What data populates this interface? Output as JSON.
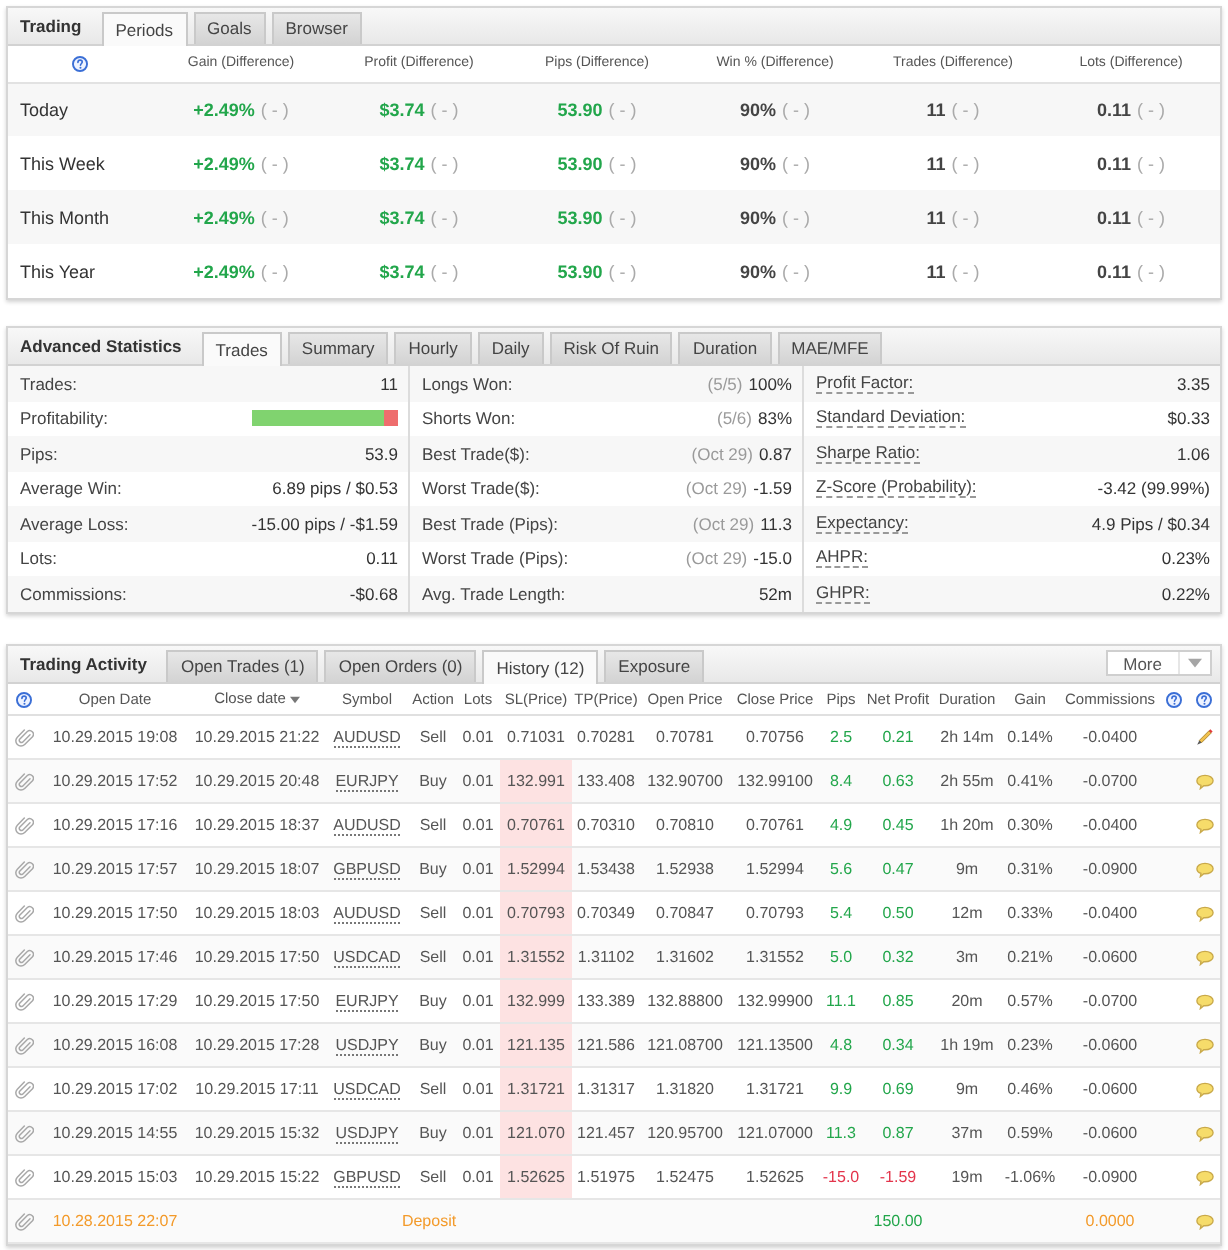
{
  "trading": {
    "title": "Trading",
    "tabs": [
      {
        "label": "Periods",
        "selected": true
      },
      {
        "label": "Goals",
        "selected": false
      },
      {
        "label": "Browser",
        "selected": false
      }
    ],
    "columns": [
      "Gain (Difference)",
      "Profit (Difference)",
      "Pips (Difference)",
      "Win % (Difference)",
      "Trades (Difference)",
      "Lots (Difference)"
    ],
    "rows": [
      {
        "period": "Today",
        "cells": [
          {
            "value": "+2.49%",
            "difference": "( - )",
            "positive": true
          },
          {
            "value": "$3.74",
            "difference": "( - )",
            "positive": true
          },
          {
            "value": "53.90",
            "difference": "( - )",
            "positive": true
          },
          {
            "value": "90%",
            "difference": "( - )",
            "positive": false
          },
          {
            "value": "11",
            "difference": "( - )",
            "positive": false
          },
          {
            "value": "0.11",
            "difference": "( - )",
            "positive": false
          }
        ]
      },
      {
        "period": "This Week",
        "cells": [
          {
            "value": "+2.49%",
            "difference": "( - )",
            "positive": true
          },
          {
            "value": "$3.74",
            "difference": "( - )",
            "positive": true
          },
          {
            "value": "53.90",
            "difference": "( - )",
            "positive": true
          },
          {
            "value": "90%",
            "difference": "( - )",
            "positive": false
          },
          {
            "value": "11",
            "difference": "( - )",
            "positive": false
          },
          {
            "value": "0.11",
            "difference": "( - )",
            "positive": false
          }
        ]
      },
      {
        "period": "This Month",
        "cells": [
          {
            "value": "+2.49%",
            "difference": "( - )",
            "positive": true
          },
          {
            "value": "$3.74",
            "difference": "( - )",
            "positive": true
          },
          {
            "value": "53.90",
            "difference": "( - )",
            "positive": true
          },
          {
            "value": "90%",
            "difference": "( - )",
            "positive": false
          },
          {
            "value": "11",
            "difference": "( - )",
            "positive": false
          },
          {
            "value": "0.11",
            "difference": "( - )",
            "positive": false
          }
        ]
      },
      {
        "period": "This Year",
        "cells": [
          {
            "value": "+2.49%",
            "difference": "( - )",
            "positive": true
          },
          {
            "value": "$3.74",
            "difference": "( - )",
            "positive": true
          },
          {
            "value": "53.90",
            "difference": "( - )",
            "positive": true
          },
          {
            "value": "90%",
            "difference": "( - )",
            "positive": false
          },
          {
            "value": "11",
            "difference": "( - )",
            "positive": false
          },
          {
            "value": "0.11",
            "difference": "( - )",
            "positive": false
          }
        ]
      }
    ]
  },
  "advanced_statistics": {
    "title": "Advanced Statistics",
    "tabs": [
      {
        "label": "Trades",
        "selected": true
      },
      {
        "label": "Summary",
        "selected": false
      },
      {
        "label": "Hourly",
        "selected": false
      },
      {
        "label": "Daily",
        "selected": false
      },
      {
        "label": "Risk Of Ruin",
        "selected": false
      },
      {
        "label": "Duration",
        "selected": false
      },
      {
        "label": "MAE/MFE",
        "selected": false
      }
    ],
    "columns": [
      {
        "tooltips": false,
        "stats": [
          {
            "kind": "value",
            "label": "Trades:",
            "value": "11"
          },
          {
            "kind": "bar",
            "label": "Profitability:",
            "level": 0.91
          },
          {
            "kind": "value",
            "label": "Pips:",
            "value": "53.9"
          },
          {
            "kind": "value",
            "label": "Average Win:",
            "value": "6.89 pips / $0.53"
          },
          {
            "kind": "value",
            "label": "Average Loss:",
            "value": "-15.00 pips / -$1.59"
          },
          {
            "kind": "value",
            "label": "Lots:",
            "value": "0.11"
          },
          {
            "kind": "value",
            "label": "Commissions:",
            "value": "-$0.68"
          }
        ]
      },
      {
        "tooltips": false,
        "stats": [
          {
            "kind": "value",
            "label": "Longs Won:",
            "note": "(5/5)",
            "value": "100%"
          },
          {
            "kind": "value",
            "label": "Shorts Won:",
            "note": "(5/6)",
            "value": "83%"
          },
          {
            "kind": "value",
            "label": "Best Trade($):",
            "note": "(Oct 29)",
            "value": "0.87"
          },
          {
            "kind": "value",
            "label": "Worst Trade($):",
            "note": "(Oct 29)",
            "value": "-1.59"
          },
          {
            "kind": "value",
            "label": "Best Trade (Pips):",
            "note": "(Oct 29)",
            "value": "11.3"
          },
          {
            "kind": "value",
            "label": "Worst Trade (Pips):",
            "note": "(Oct 29)",
            "value": "-15.0"
          },
          {
            "kind": "value",
            "label": "Avg. Trade Length:",
            "value": "52m"
          }
        ]
      },
      {
        "tooltips": true,
        "stats": [
          {
            "kind": "value",
            "label": "Profit Factor:",
            "value": "3.35"
          },
          {
            "kind": "value",
            "label": "Standard Deviation:",
            "value": "$0.33"
          },
          {
            "kind": "value",
            "label": "Sharpe Ratio:",
            "value": "1.06"
          },
          {
            "kind": "value",
            "label": "Z-Score (Probability):",
            "value": "-3.42 (99.99%)"
          },
          {
            "kind": "value",
            "label": "Expectancy:",
            "value": "4.9 Pips / $0.34"
          },
          {
            "kind": "value",
            "label": "AHPR:",
            "value": "0.23%"
          },
          {
            "kind": "value",
            "label": "GHPR:",
            "value": "0.22%"
          }
        ]
      }
    ]
  },
  "trading_activity": {
    "title": "Trading Activity",
    "tabs": [
      {
        "label": "Open Trades (1)",
        "selected": false
      },
      {
        "label": "Open Orders (0)",
        "selected": false
      },
      {
        "label": "History (12)",
        "selected": true
      },
      {
        "label": "Exposure",
        "selected": false
      }
    ],
    "more_button": "More",
    "columns": [
      {
        "label": "Open Date",
        "sorted": false
      },
      {
        "label": "Close date",
        "sorted": true
      },
      {
        "label": "Symbol",
        "sorted": false
      },
      {
        "label": "Action",
        "sorted": false
      },
      {
        "label": "Lots",
        "sorted": false
      },
      {
        "label": "SL(Price)",
        "sorted": false
      },
      {
        "label": "TP(Price)",
        "sorted": false
      },
      {
        "label": "Open Price",
        "sorted": false
      },
      {
        "label": "Close Price",
        "sorted": false
      },
      {
        "label": "Pips",
        "sorted": false
      },
      {
        "label": "Net Profit",
        "sorted": false
      },
      {
        "label": "Duration",
        "sorted": false
      },
      {
        "label": "Gain",
        "sorted": false
      },
      {
        "label": "Commissions",
        "sorted": false
      }
    ],
    "rows": [
      {
        "kind": "trade",
        "open_date": "10.29.2015 19:08",
        "close_date": "10.29.2015 21:22",
        "symbol": "AUDUSD",
        "action": "Sell",
        "lots": "0.01",
        "sl_price": "0.71031",
        "sl_highlight": false,
        "tp_price": "0.70281",
        "open_price": "0.70781",
        "close_price": "0.70756",
        "pips": "2.5",
        "net_profit": "0.21",
        "duration": "2h 14m",
        "gain": "0.14%",
        "commissions": "-0.0400",
        "loss": false,
        "has_comment": false
      },
      {
        "kind": "trade",
        "open_date": "10.29.2015 17:52",
        "close_date": "10.29.2015 20:48",
        "symbol": "EURJPY",
        "action": "Buy",
        "lots": "0.01",
        "sl_price": "132.991",
        "sl_highlight": true,
        "tp_price": "133.408",
        "open_price": "132.90700",
        "close_price": "132.99100",
        "pips": "8.4",
        "net_profit": "0.63",
        "duration": "2h 55m",
        "gain": "0.41%",
        "commissions": "-0.0700",
        "loss": false,
        "has_comment": true
      },
      {
        "kind": "trade",
        "open_date": "10.29.2015 17:16",
        "close_date": "10.29.2015 18:37",
        "symbol": "AUDUSD",
        "action": "Sell",
        "lots": "0.01",
        "sl_price": "0.70761",
        "sl_highlight": true,
        "tp_price": "0.70310",
        "open_price": "0.70810",
        "close_price": "0.70761",
        "pips": "4.9",
        "net_profit": "0.45",
        "duration": "1h 20m",
        "gain": "0.30%",
        "commissions": "-0.0400",
        "loss": false,
        "has_comment": true
      },
      {
        "kind": "trade",
        "open_date": "10.29.2015 17:57",
        "close_date": "10.29.2015 18:07",
        "symbol": "GBPUSD",
        "action": "Buy",
        "lots": "0.01",
        "sl_price": "1.52994",
        "sl_highlight": true,
        "tp_price": "1.53438",
        "open_price": "1.52938",
        "close_price": "1.52994",
        "pips": "5.6",
        "net_profit": "0.47",
        "duration": "9m",
        "gain": "0.31%",
        "commissions": "-0.0900",
        "loss": false,
        "has_comment": true
      },
      {
        "kind": "trade",
        "open_date": "10.29.2015 17:50",
        "close_date": "10.29.2015 18:03",
        "symbol": "AUDUSD",
        "action": "Sell",
        "lots": "0.01",
        "sl_price": "0.70793",
        "sl_highlight": true,
        "tp_price": "0.70349",
        "open_price": "0.70847",
        "close_price": "0.70793",
        "pips": "5.4",
        "net_profit": "0.50",
        "duration": "12m",
        "gain": "0.33%",
        "commissions": "-0.0400",
        "loss": false,
        "has_comment": true
      },
      {
        "kind": "trade",
        "open_date": "10.29.2015 17:46",
        "close_date": "10.29.2015 17:50",
        "symbol": "USDCAD",
        "action": "Sell",
        "lots": "0.01",
        "sl_price": "1.31552",
        "sl_highlight": true,
        "tp_price": "1.31102",
        "open_price": "1.31602",
        "close_price": "1.31552",
        "pips": "5.0",
        "net_profit": "0.32",
        "duration": "3m",
        "gain": "0.21%",
        "commissions": "-0.0600",
        "loss": false,
        "has_comment": true
      },
      {
        "kind": "trade",
        "open_date": "10.29.2015 17:29",
        "close_date": "10.29.2015 17:50",
        "symbol": "EURJPY",
        "action": "Buy",
        "lots": "0.01",
        "sl_price": "132.999",
        "sl_highlight": true,
        "tp_price": "133.389",
        "open_price": "132.88800",
        "close_price": "132.99900",
        "pips": "11.1",
        "net_profit": "0.85",
        "duration": "20m",
        "gain": "0.57%",
        "commissions": "-0.0700",
        "loss": false,
        "has_comment": true
      },
      {
        "kind": "trade",
        "open_date": "10.29.2015 16:08",
        "close_date": "10.29.2015 17:28",
        "symbol": "USDJPY",
        "action": "Buy",
        "lots": "0.01",
        "sl_price": "121.135",
        "sl_highlight": true,
        "tp_price": "121.586",
        "open_price": "121.08700",
        "close_price": "121.13500",
        "pips": "4.8",
        "net_profit": "0.34",
        "duration": "1h 19m",
        "gain": "0.23%",
        "commissions": "-0.0600",
        "loss": false,
        "has_comment": true
      },
      {
        "kind": "trade",
        "open_date": "10.29.2015 17:02",
        "close_date": "10.29.2015 17:11",
        "symbol": "USDCAD",
        "action": "Sell",
        "lots": "0.01",
        "sl_price": "1.31721",
        "sl_highlight": true,
        "tp_price": "1.31317",
        "open_price": "1.31820",
        "close_price": "1.31721",
        "pips": "9.9",
        "net_profit": "0.69",
        "duration": "9m",
        "gain": "0.46%",
        "commissions": "-0.0600",
        "loss": false,
        "has_comment": true
      },
      {
        "kind": "trade",
        "open_date": "10.29.2015 14:55",
        "close_date": "10.29.2015 15:32",
        "symbol": "USDJPY",
        "action": "Buy",
        "lots": "0.01",
        "sl_price": "121.070",
        "sl_highlight": true,
        "tp_price": "121.457",
        "open_price": "120.95700",
        "close_price": "121.07000",
        "pips": "11.3",
        "net_profit": "0.87",
        "duration": "37m",
        "gain": "0.59%",
        "commissions": "-0.0600",
        "loss": false,
        "has_comment": true
      },
      {
        "kind": "trade",
        "open_date": "10.29.2015 15:03",
        "close_date": "10.29.2015 15:22",
        "symbol": "GBPUSD",
        "action": "Sell",
        "lots": "0.01",
        "sl_price": "1.52625",
        "sl_highlight": true,
        "tp_price": "1.51975",
        "open_price": "1.52475",
        "close_price": "1.52625",
        "pips": "-15.0",
        "net_profit": "-1.59",
        "duration": "19m",
        "gain": "-1.06%",
        "commissions": "-0.0900",
        "loss": true,
        "has_comment": true
      },
      {
        "kind": "deposit",
        "open_date": "10.28.2015 22:07",
        "action": "Deposit",
        "net_profit": "150.00",
        "commissions": "0.0000",
        "loss": false,
        "has_comment": true
      }
    ]
  }
}
